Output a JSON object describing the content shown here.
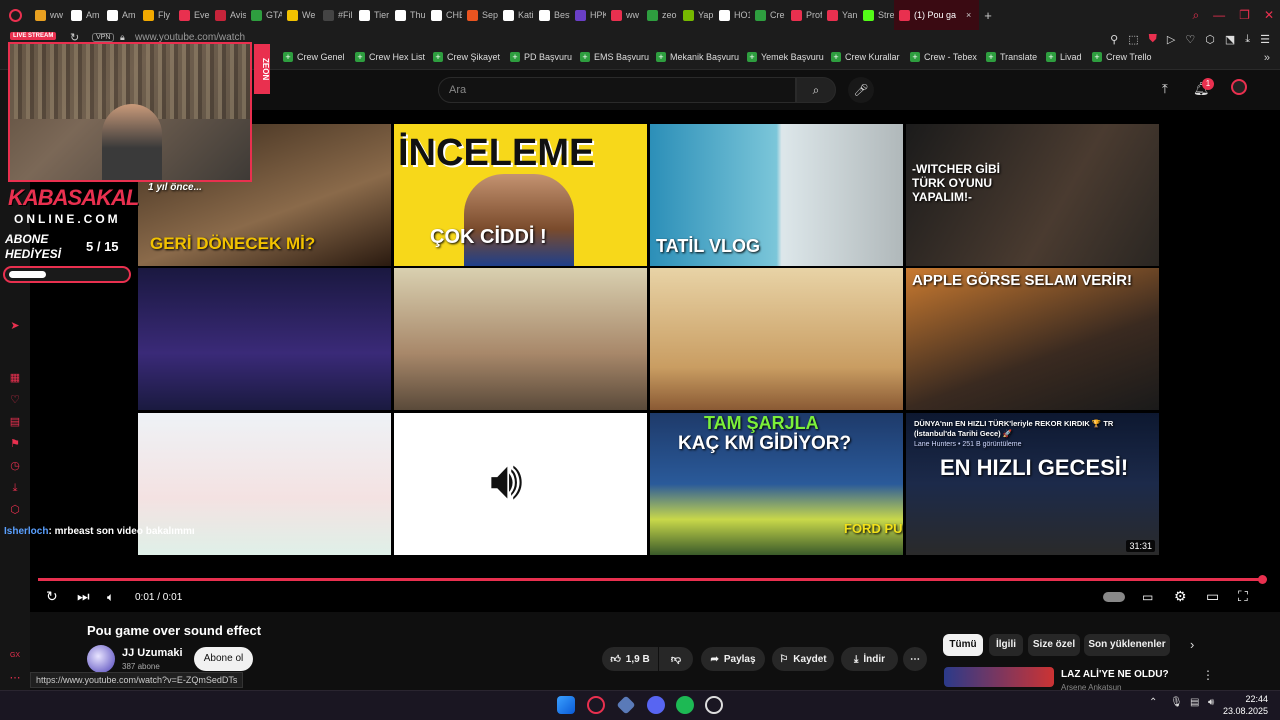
{
  "tabs": [
    {
      "label": "ww",
      "color": "#e9a020"
    },
    {
      "label": "Am",
      "color": "#ffffff"
    },
    {
      "label": "Am",
      "color": "#ffffff"
    },
    {
      "label": "Fly",
      "color": "#f2a900"
    },
    {
      "label": "Eve",
      "color": "#e9304f"
    },
    {
      "label": "Avis",
      "color": "#c7243a"
    },
    {
      "label": "GTA",
      "color": "#2e9e3f"
    },
    {
      "label": "We",
      "color": "#f2c200"
    },
    {
      "label": "#Fil",
      "color": "#444444"
    },
    {
      "label": "Tier",
      "color": "#ffffff"
    },
    {
      "label": "Thu",
      "color": "#ffffff"
    },
    {
      "label": "CHE",
      "color": "#ffffff"
    },
    {
      "label": "Sep",
      "color": "#e95420"
    },
    {
      "label": "Kati",
      "color": "#ffffff"
    },
    {
      "label": "Best",
      "color": "#ffffff"
    },
    {
      "label": "HPK",
      "color": "#6a3fc7"
    },
    {
      "label": "ww",
      "color": "#e9304f"
    },
    {
      "label": "zeo",
      "color": "#2e9e3f"
    },
    {
      "label": "Yap",
      "color": "#76b900"
    },
    {
      "label": "HO1",
      "color": "#ffffff"
    },
    {
      "label": "Cre",
      "color": "#2e9e3f"
    },
    {
      "label": "Prof",
      "color": "#e9304f"
    },
    {
      "label": "Yan",
      "color": "#e9304f"
    },
    {
      "label": "Stre",
      "color": "#53fc18"
    }
  ],
  "active_tab": "(1) Pou ga",
  "url": "www.youtube.com/watch",
  "vpn_label": "VPN",
  "bookmarks": [
    "Crew Genel",
    "Crew Hex List",
    "Crew Şikayet",
    "PD Başvuru",
    "EMS Başvuru",
    "Mekanik Başvuru",
    "Yemek Başvuru",
    "Crew Kurallar",
    "Crew - Tebex",
    "Translate",
    "Livad",
    "Crew Trello"
  ],
  "search": {
    "placeholder": "Ara"
  },
  "notification_count": "1",
  "overlay": {
    "live_label": "LIVE STREAM",
    "brand_top": "KABASAKAL",
    "brand_bottom": "ONLINE.COM",
    "goal_label_1": "ABONE",
    "goal_label_2": "HEDİYESİ",
    "goal_count": "5 / 15",
    "goal_progress": 0.33,
    "zeon_label": "ZEON",
    "chat_user": "Isherloch",
    "chat_message": ": mrbeast son video bakalımmı"
  },
  "end_screen": {
    "tile1_text": "GERİ DÖNECEK Mİ?",
    "tile1_note": "1 yıl önce...",
    "tile2_text": "İNCELEME",
    "tile2_sub": "ÇOK CİDDİ !",
    "tile3_text": "TATİL VLOG",
    "tile4_text": "-WITCHER GİBİ TÜRK OYUNU YAPALIM!-",
    "tile8_text": "APPLE GÖRSE SELAM VERİR!",
    "tile11_text1": "TAM ŞARJLA",
    "tile11_text2": "KAÇ KM GİDİYOR?",
    "tile11_brand": "FORD PUMA",
    "tile12_title": "DÜNYA'nın EN HIZLI TÜRK'leriyle REKOR KIRDIK 🏆 TR (İstanbul'da Tarihi Gece) 🚀",
    "tile12_meta": "Lane Hunters • 251 B görüntüleme",
    "tile12_big": "EN HIZLI GECESİ!",
    "tile12_duration": "31:31"
  },
  "player": {
    "time": "0:01 / 0:01",
    "progress": 1.0
  },
  "video": {
    "title": "Pou game over sound effect",
    "channel": "JJ Uzumaki",
    "subs": "387 abone",
    "subscribe_label": "Abone ol",
    "likes": "1,9 B",
    "share_label": "Paylaş",
    "save_label": "Kaydet",
    "download_label": "İndir"
  },
  "chips": [
    "Tümü",
    "İlgili",
    "Size özel",
    "Son yüklenenler"
  ],
  "related": {
    "title": "LAZ ALİ'YE NE OLDU?",
    "channel": "Arsene Ankatsun"
  },
  "status_url": "https://www.youtube.com/watch?v=E-ZQmSedDTs",
  "clock": {
    "time": "22:44",
    "date": "23.08.2025"
  }
}
